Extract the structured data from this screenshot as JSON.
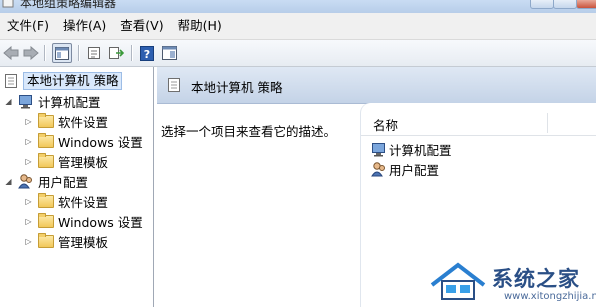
{
  "window": {
    "title": "本地组策略编辑器"
  },
  "menu": [
    "文件(F)",
    "操作(A)",
    "查看(V)",
    "帮助(H)"
  ],
  "toolbar": {
    "buttons": [
      "back-arrow-icon",
      "forward-arrow-icon",
      "show-hide-tree-icon",
      "properties-icon",
      "export-list-icon",
      "help-icon",
      "show-pane-icon"
    ]
  },
  "tree": {
    "root": "本地计算机 策略",
    "computer_config": "计算机配置",
    "computer_children": [
      "软件设置",
      "Windows 设置",
      "管理模板"
    ],
    "user_config": "用户配置",
    "user_children": [
      "软件设置",
      "Windows 设置",
      "管理模板"
    ]
  },
  "details": {
    "header_title": "本地计算机 策略",
    "description": "选择一个项目来查看它的描述。",
    "column_name": "名称",
    "items": [
      "计算机配置",
      "用户配置"
    ]
  },
  "watermark": {
    "text": "系统之家",
    "url": "www.xitongzhijia.net"
  },
  "colors": {
    "header_bg": "#c4d3e7",
    "selection_bg": "#d9e8fb",
    "watermark": "#2a4f86"
  }
}
